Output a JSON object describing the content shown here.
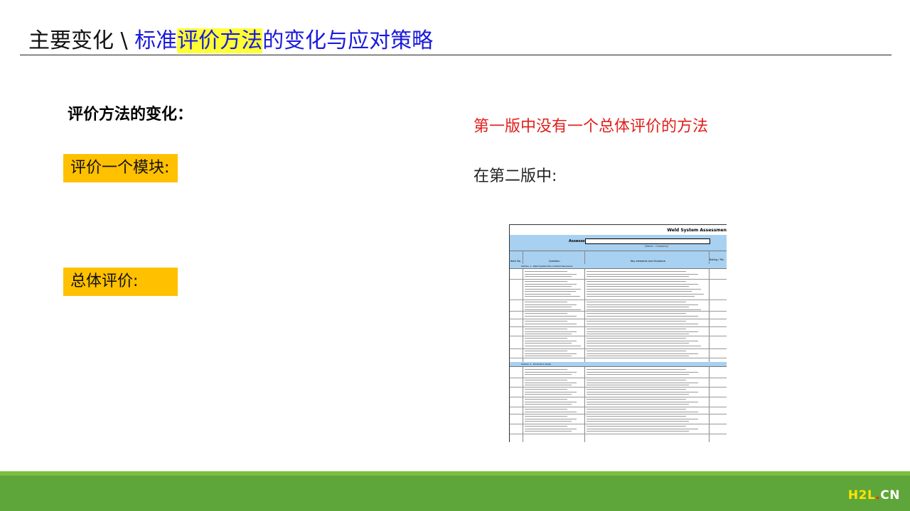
{
  "title": {
    "part1": "主要变化 \\ ",
    "part2": "标准",
    "highlight": "评价方法",
    "part3": "的变化与应对策略"
  },
  "left": {
    "heading": "评价方法的变化：",
    "tag_module": "评价一个模块:",
    "tag_overall": "总体评价:"
  },
  "right": {
    "red_note": "第一版中没有一个总体评价的方法",
    "black_note": "在第二版中:"
  },
  "sheet": {
    "title": "Weld System Assessmen",
    "assessor_label": "Assessor",
    "assessor_sub": "(Name - Company)",
    "col_item": "Item No.",
    "col_question": "Question",
    "col_req": "Key elements and Guidance",
    "col_rating": "Rating / Pts",
    "section1": "Section 1 - Weld System Pre-contract Assurance",
    "section2": "Section 2 - Production Rules"
  },
  "logo": {
    "h2l": "H2L",
    "dot": ".",
    "cn": "CN"
  },
  "colors": {
    "highlight": "#ffff33",
    "title_blue": "#1a1adc",
    "tag": "#ffc000",
    "red": "#e0201c",
    "footer_green": "#5fa63a"
  }
}
